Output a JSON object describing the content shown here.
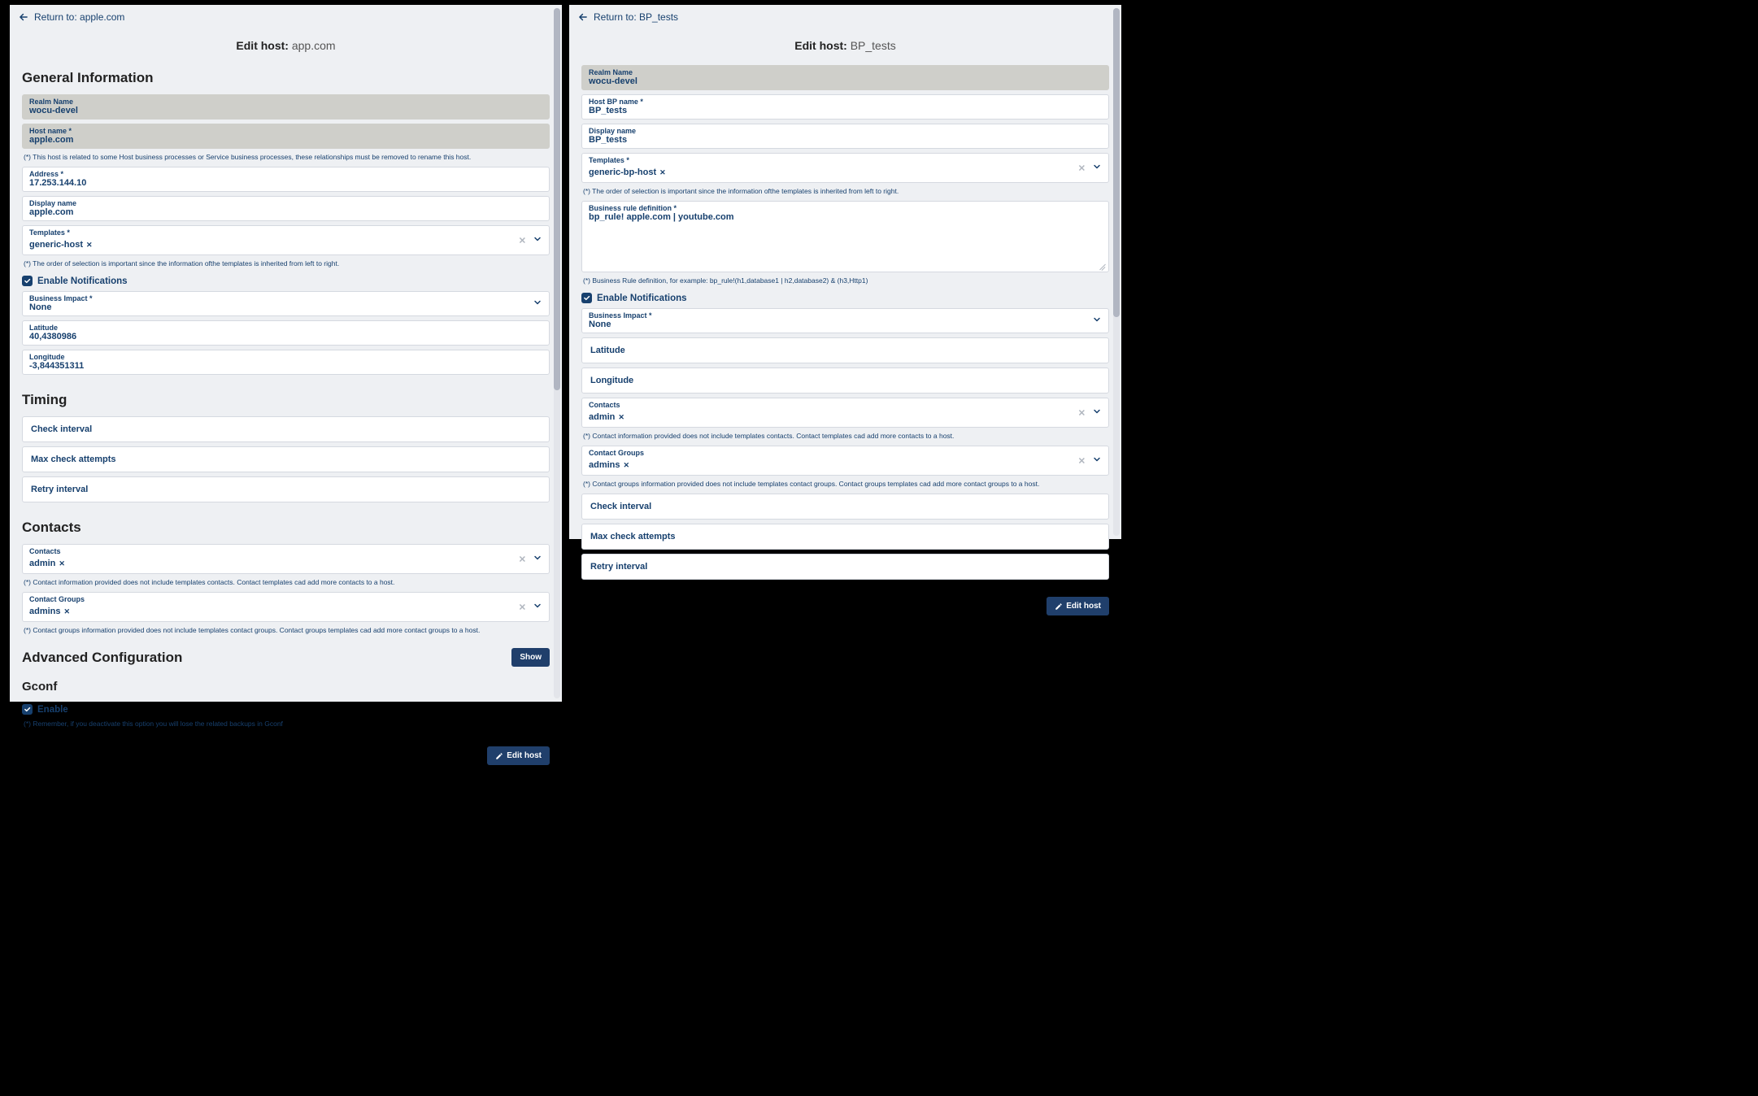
{
  "left": {
    "back_label": "Return to: apple.com",
    "title_prefix": "Edit host:",
    "title_value": "app.com",
    "sections": {
      "general": {
        "heading": "General Information",
        "realm_label": "Realm Name",
        "realm_value": "wocu-devel",
        "hostname_label": "Host name *",
        "hostname_value": "apple.com",
        "hostname_note": "(*) This host is related to some Host business processes or Service business processes, these relationships must be removed to rename this host.",
        "address_label": "Address *",
        "address_value": "17.253.144.10",
        "display_label": "Display name",
        "display_value": "apple.com",
        "templates_label": "Templates *",
        "templates_chip": "generic-host",
        "templates_note": "(*) The order of selection is important since the information ofthe templates is inherited from left to right.",
        "enable_notifications": "Enable Notifications",
        "bi_label": "Business Impact *",
        "bi_value": "None",
        "lat_label": "Latitude",
        "lat_value": "40,4380986",
        "lon_label": "Longitude",
        "lon_value": "-3,844351311"
      },
      "timing": {
        "heading": "Timing",
        "check_interval": "Check interval",
        "max_attempts": "Max check attempts",
        "retry_interval": "Retry interval"
      },
      "contacts": {
        "heading": "Contacts",
        "contacts_label": "Contacts",
        "contacts_chip": "admin",
        "contacts_note": "(*) Contact information provided does not include templates contacts. Contact templates cad add more contacts to a host.",
        "groups_label": "Contact Groups",
        "groups_chip": "admins",
        "groups_note": "(*) Contact groups information provided does not include templates contact groups. Contact groups templates cad add more contact groups to a host."
      },
      "advanced": {
        "heading": "Advanced Configuration",
        "show_btn": "Show"
      },
      "gconf": {
        "heading": "Gconf",
        "enable": "Enable",
        "note": "(*) Remember, if you deactivate this option you will lose the related backups in Gconf"
      }
    },
    "edit_btn": "Edit host"
  },
  "right": {
    "back_label": "Return to: BP_tests",
    "title_prefix": "Edit host:",
    "title_value": "BP_tests",
    "realm_label": "Realm Name",
    "realm_value": "wocu-devel",
    "bpname_label": "Host BP name *",
    "bpname_value": "BP_tests",
    "display_label": "Display name",
    "display_value": "BP_tests",
    "templates_label": "Templates *",
    "templates_chip": "generic-bp-host",
    "templates_note": "(*) The order of selection is important since the information ofthe templates is inherited from left to right.",
    "brd_label": "Business rule definition *",
    "brd_value": "bp_rule! apple.com | youtube.com",
    "brd_note": "(*) Business Rule definition, for example: bp_rule!(h1,database1 | h2,database2) & (h3,Http1)",
    "enable_notifications": "Enable Notifications",
    "bi_label": "Business Impact *",
    "bi_value": "None",
    "lat_label": "Latitude",
    "lon_label": "Longitude",
    "contacts_label": "Contacts",
    "contacts_chip": "admin",
    "contacts_note": "(*) Contact information provided does not include templates contacts. Contact templates cad add more contacts to a host.",
    "groups_label": "Contact Groups",
    "groups_chip": "admins",
    "groups_note": "(*) Contact groups information provided does not include templates contact groups. Contact groups templates cad add more contact groups to a host.",
    "check_interval": "Check interval",
    "max_attempts": "Max check attempts",
    "retry_interval": "Retry interval",
    "edit_btn": "Edit host"
  }
}
